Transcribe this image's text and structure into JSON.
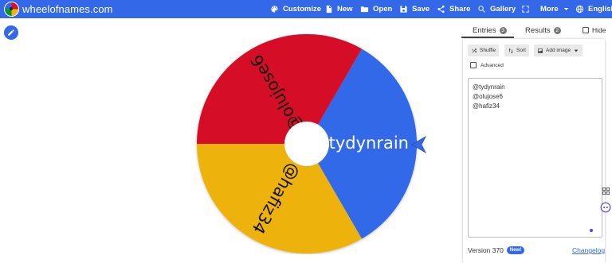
{
  "header": {
    "site_title": "wheelofnames.com",
    "nav": [
      {
        "label": "Customize",
        "icon": "palette-icon"
      },
      {
        "label": "New",
        "icon": "file-icon"
      },
      {
        "label": "Open",
        "icon": "folder-icon"
      },
      {
        "label": "Save",
        "icon": "save-icon"
      },
      {
        "label": "Share",
        "icon": "share-icon"
      },
      {
        "label": "Gallery",
        "icon": "search-icon"
      },
      {
        "label": "",
        "icon": "fullscreen-icon"
      },
      {
        "label": "More",
        "icon": "chevron-down-icon"
      },
      {
        "label": "English",
        "icon": "globe-icon"
      }
    ],
    "bar_color": "#3369e8"
  },
  "wheel": {
    "segments": [
      {
        "label": "@tydynrain",
        "color": "#3369e8"
      },
      {
        "label": "@olujose6",
        "color": "#d61126"
      },
      {
        "label": "@hafiz34",
        "color": "#eeb211"
      }
    ],
    "pointer_icon": "pointer-arrow-icon"
  },
  "panel": {
    "tabs": [
      {
        "label": "Entries",
        "count": "3"
      },
      {
        "label": "Results",
        "count": "2"
      }
    ],
    "hide_label": "Hide",
    "toolbar": {
      "shuffle": "Shuffle",
      "sort": "Sort",
      "add_image": "Add image"
    },
    "advanced_label": "Advanced",
    "entries": [
      "@tydynrain",
      "@olujose6",
      "@hafiz34"
    ]
  },
  "footer": {
    "version": "Version 370",
    "new_badge": "New!",
    "changelog": "Changelog"
  }
}
